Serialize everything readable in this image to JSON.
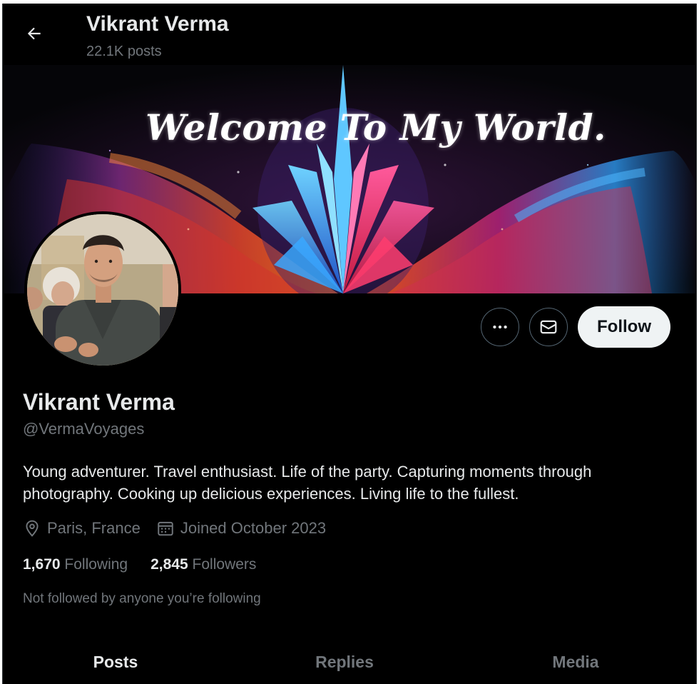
{
  "header": {
    "name": "Vikrant Verma",
    "posts_count": "22.1K posts"
  },
  "banner": {
    "title": "Welcome To My World."
  },
  "actions": {
    "more_icon": "more-horizontal-icon",
    "message_icon": "envelope-icon",
    "follow_label": "Follow"
  },
  "profile": {
    "name": "Vikrant Verma",
    "handle": "@VermaVoyages",
    "bio": "Young adventurer. Travel enthusiast. Life of the party. Capturing moments through photography. Cooking up delicious experiences. Living life to the fullest.",
    "location": "Paris, France",
    "joined": "Joined October 2023"
  },
  "stats": {
    "following_count": "1,670",
    "following_label": "Following",
    "followers_count": "2,845",
    "followers_label": "Followers"
  },
  "not_followed_text": "Not followed by anyone you’re following",
  "tabs": [
    {
      "label": "Posts",
      "active": true
    },
    {
      "label": "Replies",
      "active": false
    },
    {
      "label": "Media",
      "active": false
    }
  ],
  "colors": {
    "background": "#000000",
    "text_primary": "#e7e9ea",
    "text_secondary": "#71767b",
    "follow_button_bg": "#eff3f4"
  }
}
